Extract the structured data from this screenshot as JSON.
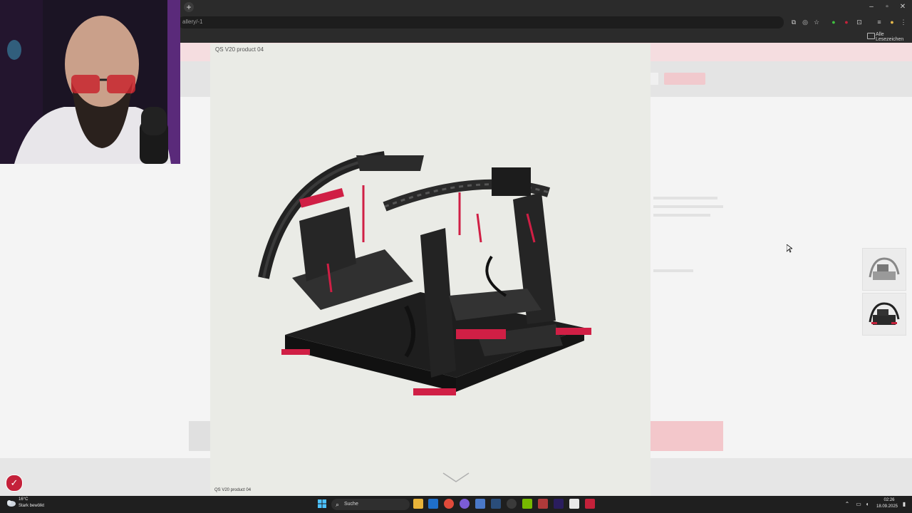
{
  "browser": {
    "url_fragment": "allery/-1",
    "bookmarks_label": "Alle Lesezeichen",
    "new_tab_label": "+",
    "window_controls": [
      "–",
      "▫",
      "✕"
    ]
  },
  "modal": {
    "title": "QS V20 product 04",
    "caption": "QS V20 product 04",
    "accent_color": "#d01f45"
  },
  "webcam": {
    "icon": "person-webcam"
  },
  "taskbar": {
    "weather_temp": "16°C",
    "weather_desc": "Stark bewölkt",
    "search_label": "Suche",
    "time": "02:26",
    "date": "18.09.2025"
  },
  "colors": {
    "chrome_bg": "#2b2b2b",
    "taskbar_bg": "#1f1f1f",
    "brand_red": "#c4213a"
  }
}
